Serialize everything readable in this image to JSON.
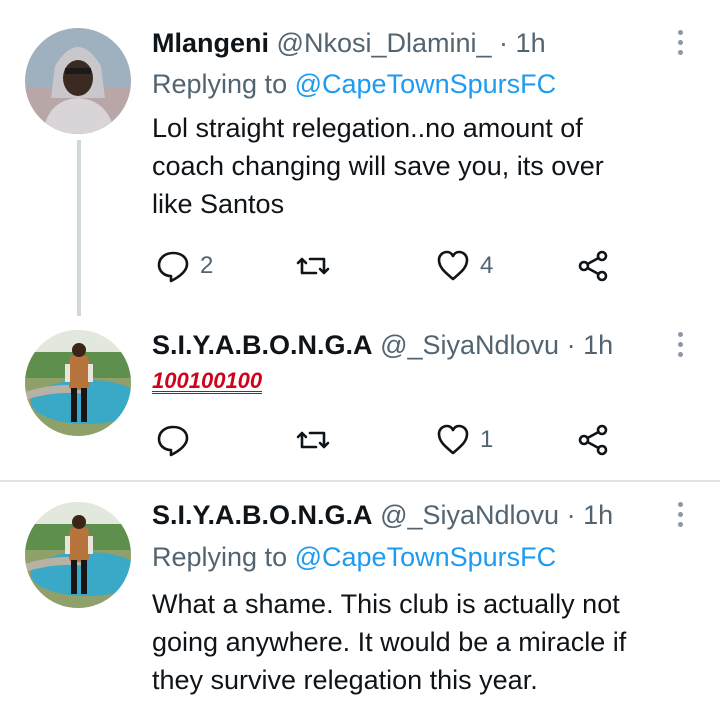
{
  "tweets": [
    {
      "name": "Mlangeni",
      "handle": "@Nkosi_Dlamini_",
      "time": "1h",
      "replying_prefix": "Replying to",
      "replying_to": "@CapeTownSpursFC",
      "text_lines": [
        "Lol straight relegation..no amount of",
        "coach changing will save you, its over",
        "like Santos"
      ],
      "replies": "2",
      "retweets": "",
      "likes": "4",
      "avatar_icon": "avatar-hooded-man-icon"
    },
    {
      "name": "S.I.Y.A.B.O.N.G.A",
      "handle": "@_SiyaNdlovu",
      "time": "1h",
      "emoji_text": "💯💯💯",
      "emoji_glyphs": [
        "100",
        "100",
        "100"
      ],
      "replies": "",
      "retweets": "",
      "likes": "1",
      "avatar_icon": "avatar-man-by-pool-icon"
    },
    {
      "name": "S.I.Y.A.B.O.N.G.A",
      "handle": "@_SiyaNdlovu",
      "time": "1h",
      "replying_prefix": "Replying to",
      "replying_to": "@CapeTownSpursFC",
      "text_lines": [
        "What a shame. This club is actually not",
        "going anywhere. It would be a miracle if",
        "they survive relegation this year."
      ],
      "avatar_icon": "avatar-man-by-pool-icon"
    }
  ],
  "separator": "·",
  "colors": {
    "link": "#1d9bf0",
    "secondary": "#536471",
    "text": "#0f1419",
    "emoji": "#d0021b"
  }
}
